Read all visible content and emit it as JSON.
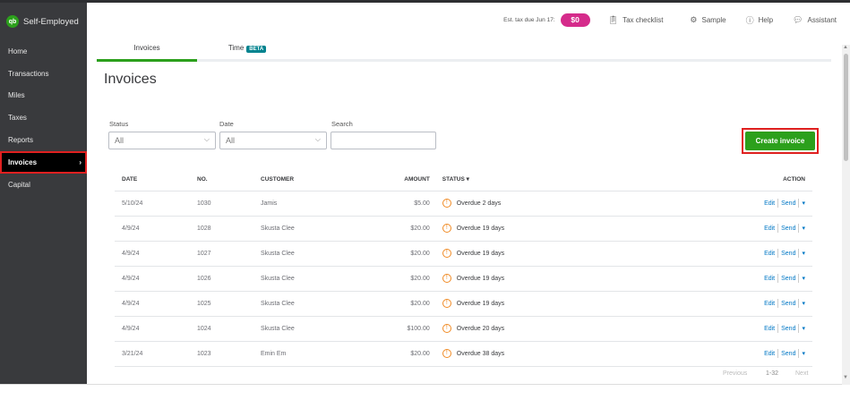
{
  "sidebar": {
    "brand": "Self-Employed",
    "logo": "qb",
    "items": [
      {
        "label": "Home"
      },
      {
        "label": "Transactions"
      },
      {
        "label": "Miles"
      },
      {
        "label": "Taxes"
      },
      {
        "label": "Reports"
      },
      {
        "label": "Invoices",
        "active": true
      },
      {
        "label": "Capital"
      }
    ]
  },
  "header": {
    "est_tax_label": "Est. tax due Jun 17:",
    "est_tax_value": "$0",
    "tax_checklist": "Tax checklist",
    "sample": "Sample",
    "help": "Help",
    "assistant": "Assistant"
  },
  "tabs": [
    {
      "label": "Invoices"
    },
    {
      "label": "Time",
      "badge": "BETA"
    }
  ],
  "page_title": "Invoices",
  "filters": {
    "status_label": "Status",
    "status_value": "All",
    "date_label": "Date",
    "date_value": "All",
    "search_label": "Search",
    "search_value": ""
  },
  "create_button": "Create invoice",
  "table": {
    "headers": {
      "date": "DATE",
      "no": "NO.",
      "customer": "CUSTOMER",
      "amount": "AMOUNT",
      "status": "STATUS ▾",
      "action": "ACTION"
    },
    "rows": [
      {
        "date": "5/10/24",
        "no": "1030",
        "customer": "Jamis",
        "amount": "$5.00",
        "status": "Overdue 2 days"
      },
      {
        "date": "4/9/24",
        "no": "1028",
        "customer": "Skusta Clee",
        "amount": "$20.00",
        "status": "Overdue 19 days"
      },
      {
        "date": "4/9/24",
        "no": "1027",
        "customer": "Skusta Clee",
        "amount": "$20.00",
        "status": "Overdue 19 days"
      },
      {
        "date": "4/9/24",
        "no": "1026",
        "customer": "Skusta Clee",
        "amount": "$20.00",
        "status": "Overdue 19 days"
      },
      {
        "date": "4/9/24",
        "no": "1025",
        "customer": "Skusta Clee",
        "amount": "$20.00",
        "status": "Overdue 19 days"
      },
      {
        "date": "4/9/24",
        "no": "1024",
        "customer": "Skusta Clee",
        "amount": "$100.00",
        "status": "Overdue 20 days"
      },
      {
        "date": "3/21/24",
        "no": "1023",
        "customer": "Emin Em",
        "amount": "$20.00",
        "status": "Overdue 38 days"
      }
    ],
    "edit_label": "Edit",
    "send_label": "Send"
  },
  "pagination": {
    "previous": "Previous",
    "range": "1-32",
    "next": "Next"
  }
}
